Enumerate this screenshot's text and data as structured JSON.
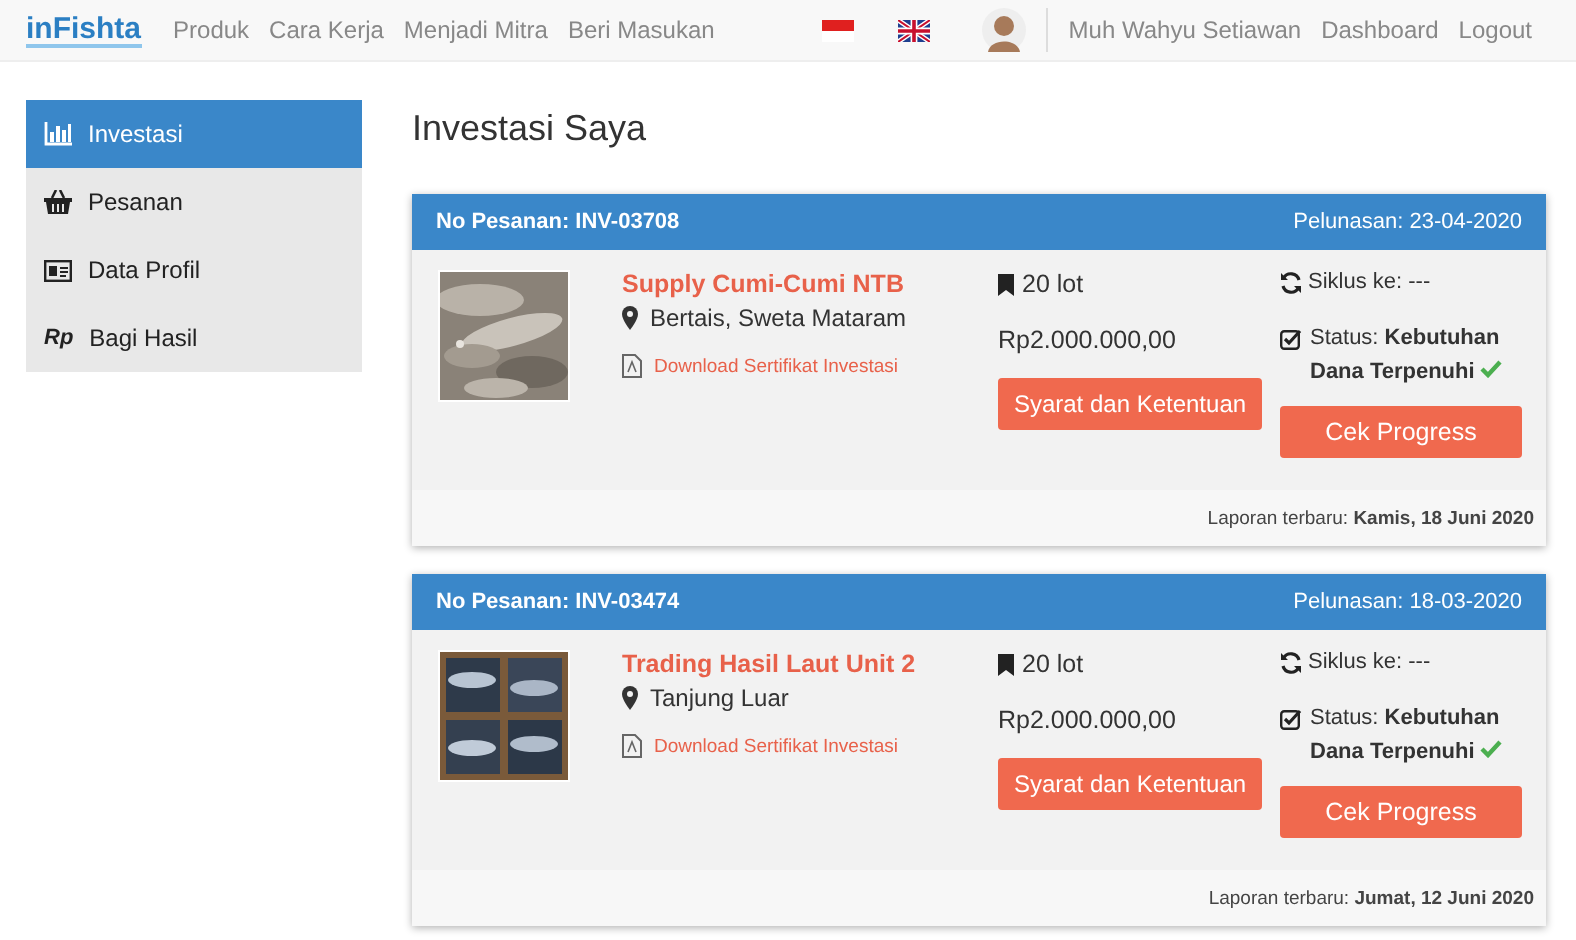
{
  "navbar": {
    "logo": "inFishta",
    "links": [
      "Produk",
      "Cara Kerja",
      "Menjadi Mitra",
      "Beri Masukan"
    ],
    "user_name": "Muh Wahyu Setiawan",
    "right_links": [
      "Dashboard",
      "Logout"
    ]
  },
  "sidebar": {
    "items": [
      {
        "label": "Investasi",
        "selected": true
      },
      {
        "label": "Pesanan",
        "selected": false
      },
      {
        "label": "Data Profil",
        "selected": false
      },
      {
        "label": "Bagi Hasil",
        "icon_text": "Rp",
        "selected": false
      }
    ]
  },
  "page_title": "Investasi Saya",
  "orders": [
    {
      "order_no": "No Pesanan: INV-03708",
      "settlement": "Pelunasan: 23-04-2020",
      "product": "Supply Cumi-Cumi NTB",
      "location": "Bertais, Sweta Mataram",
      "download": "Download Sertifikat Investasi",
      "lots": "20 lot",
      "amount": "Rp2.000.000,00",
      "terms_button": "Syarat dan Ketentuan",
      "cycle": "Siklus ke: ---",
      "status": "Status: **Kebutuhan Dana Terpenuhi**",
      "status_ok": true,
      "progress_button": "Cek Progress",
      "report": "Laporan terbaru: **Kamis, 18 Juni 2020**"
    },
    {
      "order_no": "No Pesanan: INV-03474",
      "settlement": "Pelunasan: 18-03-2020",
      "product": "Trading Hasil Laut Unit 2",
      "location": "Tanjung Luar",
      "download": "Download Sertifikat Investasi",
      "lots": "20 lot",
      "amount": "Rp2.000.000,00",
      "terms_button": "Syarat dan Ketentuan",
      "cycle": "Siklus ke: ---",
      "status": "Status: **Kebutuhan Dana Terpenuhi**",
      "status_ok": true,
      "progress_button": "Cek Progress",
      "report": "Laporan terbaru: **Jumat, 12 Juni 2020**"
    }
  ]
}
